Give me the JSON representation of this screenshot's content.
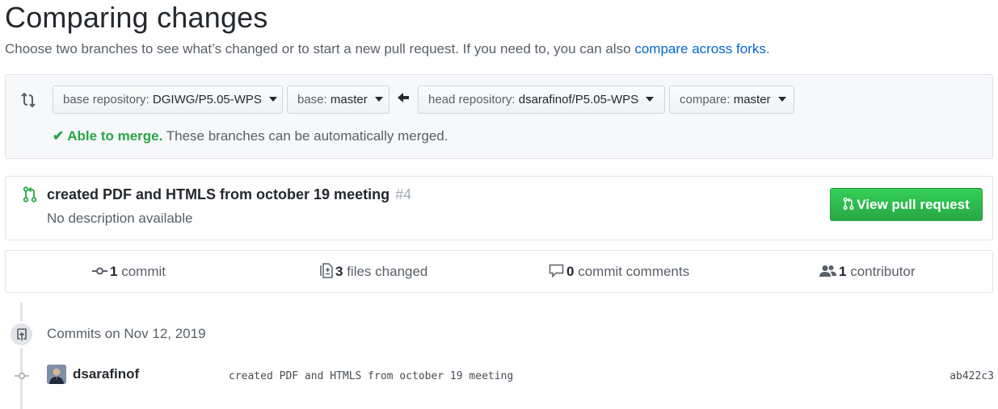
{
  "header": {
    "title": "Comparing changes",
    "subtitle": "Choose two branches to see what’s changed or to start a new pull request. If you need to, you can also ",
    "subtitle_link": "compare across forks",
    "subtitle_end": "."
  },
  "range": {
    "base_repo_label": "base repository:",
    "base_repo_value": "DGIWG/P5.05-WPS",
    "base_label": "base:",
    "base_value": "master",
    "head_repo_label": "head repository:",
    "head_repo_value": "dsarafinof/P5.05-WPS",
    "compare_label": "compare:",
    "compare_value": "master",
    "merge_ok": "Able to merge.",
    "merge_text": " These branches can be automatically merged."
  },
  "pull_request": {
    "title": "created PDF and HTMLS from october 19 meeting",
    "number": "#4",
    "description": "No description available",
    "button_label": "View pull request"
  },
  "summary": {
    "commits_count": "1",
    "commits_label": "commit",
    "files_count": "3",
    "files_label": "files changed",
    "comments_count": "0",
    "comments_label": "commit comments",
    "contributors_count": "1",
    "contributors_label": "contributor"
  },
  "commits": {
    "date_heading": "Commits on Nov 12, 2019",
    "items": [
      {
        "author": "dsarafinof",
        "message": "created PDF and HTMLS from october 19 meeting",
        "sha": "ab422c3"
      }
    ]
  },
  "colors": {
    "link": "#0366d6",
    "success": "#28a745",
    "muted": "#586069"
  },
  "icons": [
    "compare-icon",
    "arrow-left-icon",
    "check-icon",
    "git-pull-request-icon",
    "git-commit-icon",
    "file-diff-icon",
    "comment-icon",
    "people-icon",
    "repo-push-icon"
  ]
}
